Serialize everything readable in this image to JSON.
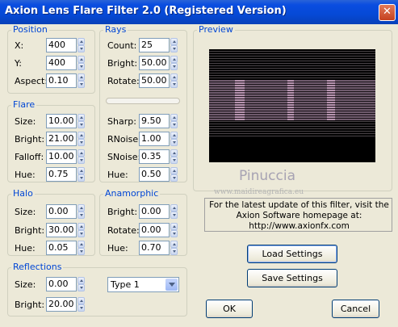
{
  "window": {
    "title": "Axion Lens Flare Filter 2.0 (Registered Version)",
    "close_glyph": "✕"
  },
  "position": {
    "title": "Position",
    "x": {
      "label": "X:",
      "value": "400"
    },
    "y": {
      "label": "Y:",
      "value": "400"
    },
    "aspect": {
      "label": "Aspect:",
      "value": "0.10"
    }
  },
  "rays": {
    "title": "Rays",
    "count": {
      "label": "Count:",
      "value": "25"
    },
    "bright": {
      "label": "Bright:",
      "value": "50.00"
    },
    "rotate": {
      "label": "Rotate:",
      "value": "50.00"
    },
    "sharp": {
      "label": "Sharp:",
      "value": "9.50"
    },
    "rnoise": {
      "label": "RNoise:",
      "value": "1.00"
    },
    "snoise": {
      "label": "SNoise:",
      "value": "0.35"
    },
    "hue": {
      "label": "Hue:",
      "value": "0.50"
    }
  },
  "flare": {
    "title": "Flare",
    "size": {
      "label": "Size:",
      "value": "10.00"
    },
    "bright": {
      "label": "Bright:",
      "value": "21.00"
    },
    "falloff": {
      "label": "Falloff:",
      "value": "10.00"
    },
    "hue": {
      "label": "Hue:",
      "value": "0.75"
    }
  },
  "halo": {
    "title": "Halo",
    "size": {
      "label": "Size:",
      "value": "0.00"
    },
    "bright": {
      "label": "Bright:",
      "value": "30.00"
    },
    "hue": {
      "label": "Hue:",
      "value": "0.05"
    }
  },
  "anamorphic": {
    "title": "Anamorphic",
    "bright": {
      "label": "Bright:",
      "value": "0.00"
    },
    "rotate": {
      "label": "Rotate:",
      "value": "0.00"
    },
    "hue": {
      "label": "Hue:",
      "value": "0.70"
    }
  },
  "reflections": {
    "title": "Reflections",
    "size": {
      "label": "Size:",
      "value": "0.00"
    },
    "bright": {
      "label": "Bright:",
      "value": "20.00"
    },
    "type_selected": "Type 1"
  },
  "preview": {
    "title": "Preview",
    "watermark_name": "Pinuccia",
    "watermark_url": "www.maidireagrafica.eu"
  },
  "info": {
    "line1": "For the latest update of this filter, visit the",
    "line2": "Axion Software homepage at:",
    "line3": "http://www.axionfx.com"
  },
  "buttons": {
    "load": "Load Settings",
    "save": "Save Settings",
    "ok": "OK",
    "cancel": "Cancel"
  },
  "colors": {
    "titlebar": "#0549d6",
    "group_title": "#0046d5",
    "dialog_bg": "#ece9d8"
  }
}
